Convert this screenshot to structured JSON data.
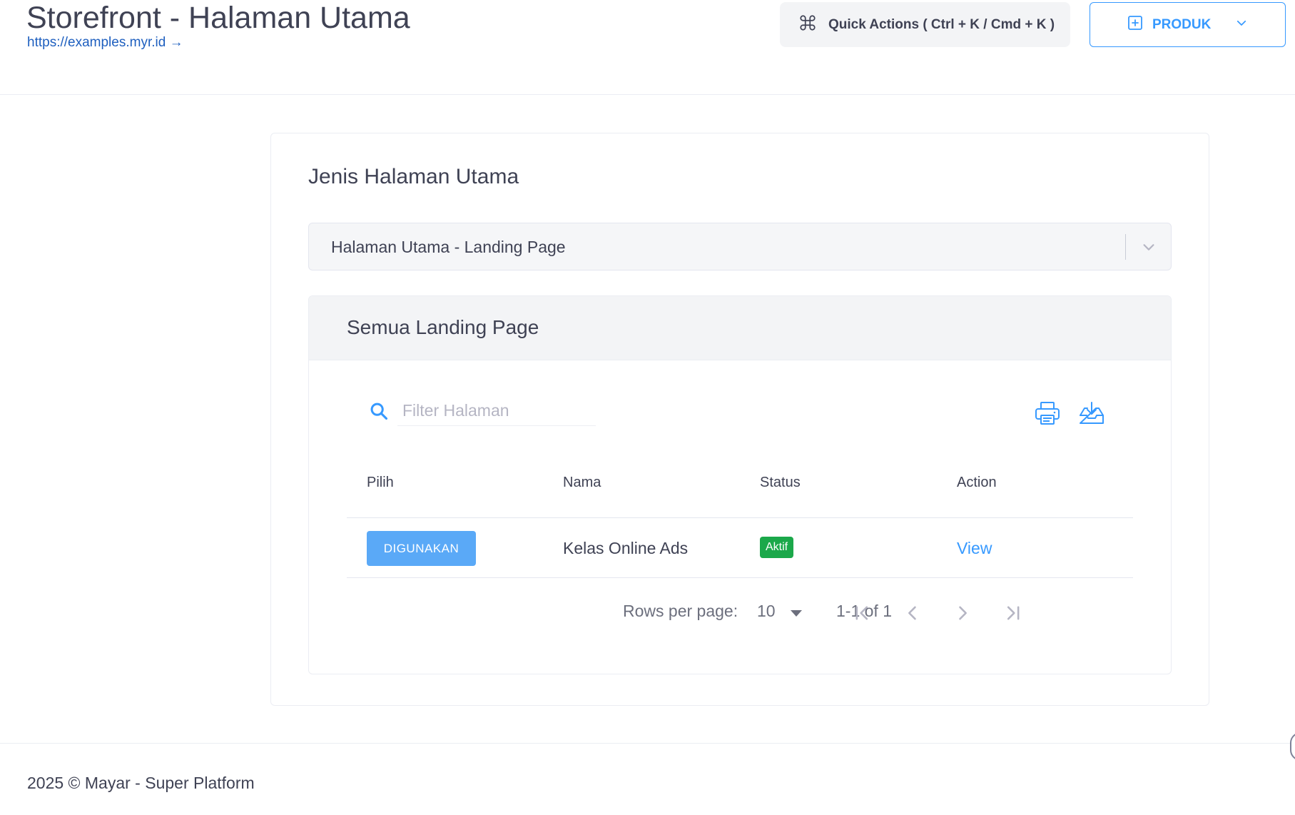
{
  "header": {
    "title": "Storefront - Halaman Utama",
    "url": "https://examples.myr.id →",
    "quick_actions_label": "Quick Actions ( Ctrl + K / Cmd + K )",
    "produk_label": "PRODUK"
  },
  "main": {
    "section_title": "Jenis Halaman Utama",
    "select": {
      "value": "Halaman Utama - Landing Page"
    },
    "table_card": {
      "title": "Semua Landing Page",
      "search_placeholder": "Filter Halaman",
      "columns": [
        "Pilih",
        "Nama",
        "Status",
        "Action"
      ],
      "rows": [
        {
          "pilih": "DIGUNAKAN",
          "nama": "Kelas Online Ads",
          "status": "Aktif",
          "action": "View"
        }
      ],
      "pagination": {
        "rows_per_page_label": "Rows per page:",
        "rows_per_page": "10",
        "range": "1-1 of 1"
      }
    }
  },
  "footer": {
    "text": "2025 © Mayar - Super Platform"
  },
  "colors": {
    "primary": "#3699ff",
    "success": "#1ba84a",
    "text": "#3f4254",
    "muted": "#6c6f7d",
    "surface": "#f3f4f6"
  },
  "icons": {
    "quick_actions": "command-icon",
    "produk": "plus-square-icon",
    "search": "search-icon",
    "print": "printer-icon",
    "download": "inbox-download-icon"
  }
}
